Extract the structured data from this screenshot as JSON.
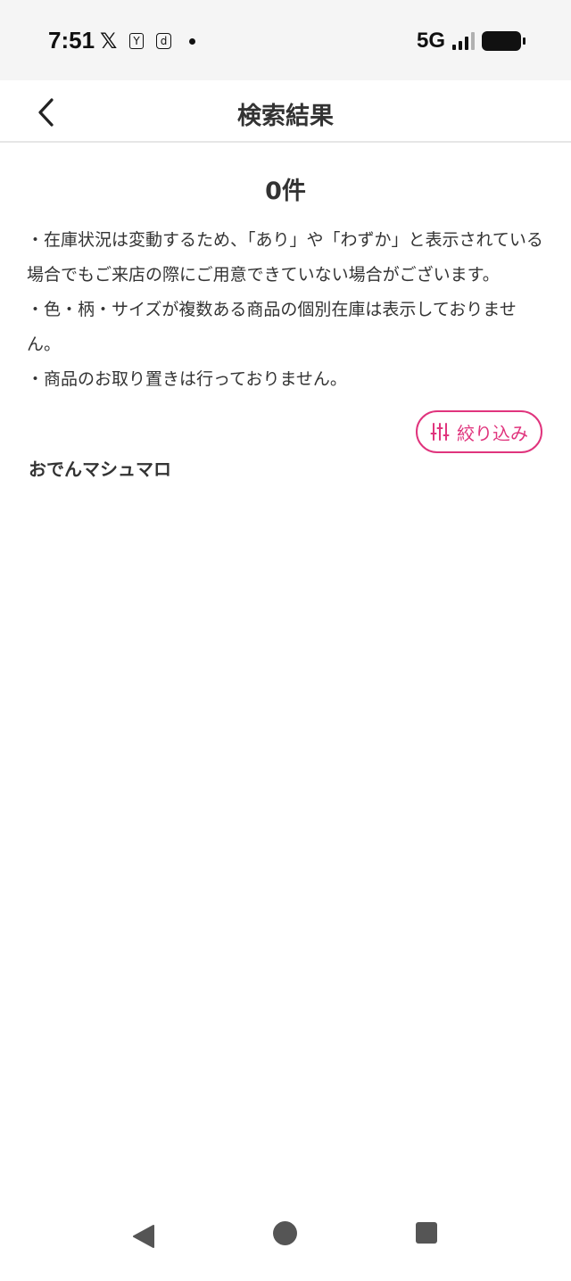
{
  "status_bar": {
    "time": "7:51",
    "network": "5G",
    "signal_level": 0.75,
    "icons": [
      "x-icon",
      "yahoo-mail-icon",
      "d-account-icon",
      "notification-dot"
    ]
  },
  "header": {
    "back_icon": "chevron-left-icon",
    "title": "検索結果"
  },
  "results": {
    "count_label": "0件",
    "keyword": "おでんマシュマロ"
  },
  "notes": [
    "・在庫状況は変動するため、「あり」や「わずか」と表示されている場合でもご来店の際にご用意できていない場合がございます。",
    "・色・柄・サイズが複数ある商品の個別在庫は表示しておりません。",
    "・商品のお取り置きは行っておりません。"
  ],
  "filter": {
    "icon": "sliders-icon",
    "label": "絞り込み"
  },
  "colors": {
    "accent": "#e0347d",
    "text": "#333333",
    "status_bar_bg": "#f5f5f5"
  },
  "nav_bar": {
    "icons": [
      "nav-back-icon",
      "nav-home-icon",
      "nav-recent-icon"
    ]
  }
}
